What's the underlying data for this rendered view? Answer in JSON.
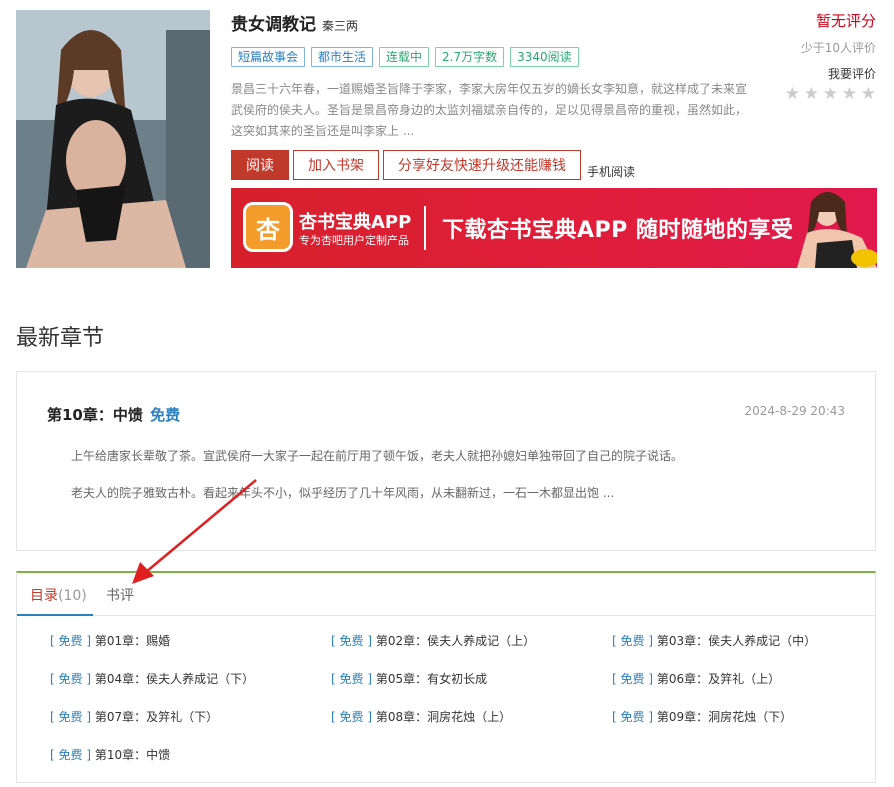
{
  "book": {
    "title": "贵女调教记",
    "author": "秦三两",
    "tags": [
      {
        "label": "短篇故事会",
        "color": "blue"
      },
      {
        "label": "都市生活",
        "color": "blue"
      },
      {
        "label": "连载中",
        "color": "green"
      },
      {
        "label": "2.7万字数",
        "color": "green"
      },
      {
        "label": "3340阅读",
        "color": "green"
      }
    ],
    "description": "景昌三十六年春，一道赐婚圣旨降于李家，李家大房年仅五岁的嫡长女李知意，就这样成了未来宣武侯府的侯夫人。圣旨是景昌帝身边的太监刘福斌亲自传的，足以见得景昌帝的重视，虽然如此，这突如其来的圣旨还是叫李家上 ..."
  },
  "actions": {
    "read": "阅读",
    "add_shelf": "加入书架",
    "share": "分享好友快速升级还能赚钱",
    "mobile": "手机阅读"
  },
  "banner": {
    "app_name": "杏书宝典APP",
    "subtitle": "专为杏吧用户定制产品",
    "slogan": "下载杏书宝典APP 随时随地的享受",
    "logo_glyph": "杏"
  },
  "rating": {
    "value": "暂无评分",
    "count": "少于10人评价",
    "rate_label": "我要评价",
    "stars": 5
  },
  "latest": {
    "heading": "最新章节",
    "chapter_title": "第10章：中馈",
    "free_label": "免费",
    "time": "2024-8-29 20:43",
    "p1": "上午给唐家长辈敬了茶。宣武侯府一大家子一起在前厅用了顿午饭，老夫人就把孙媳妇单独带回了自己的院子说话。",
    "p2": "老夫人的院子雅致古朴。看起来年头不小，似乎经历了几十年风雨，从未翻新过，一石一木都显出饱 ..."
  },
  "tabs": {
    "directory": "目录",
    "directory_count": "(10)",
    "reviews": "书评"
  },
  "chapters": [
    {
      "free": "免费",
      "title": "第01章：赐婚"
    },
    {
      "free": "免费",
      "title": "第02章：侯夫人养成记（上）"
    },
    {
      "free": "免费",
      "title": "第03章：侯夫人养成记（中）"
    },
    {
      "free": "免费",
      "title": "第04章：侯夫人养成记（下）"
    },
    {
      "free": "免费",
      "title": "第05章：有女初长成"
    },
    {
      "free": "免费",
      "title": "第06章：及笄礼（上）"
    },
    {
      "free": "免费",
      "title": "第07章：及笄礼（下）"
    },
    {
      "free": "免费",
      "title": "第08章：洞房花烛（上）"
    },
    {
      "free": "免费",
      "title": "第09章：洞房花烛（下）"
    },
    {
      "free": "免费",
      "title": "第10章：中馈"
    }
  ],
  "colors": {
    "accent_red": "#c0392b",
    "link_blue": "#2a7fc0",
    "tab_green": "#7cb342"
  }
}
